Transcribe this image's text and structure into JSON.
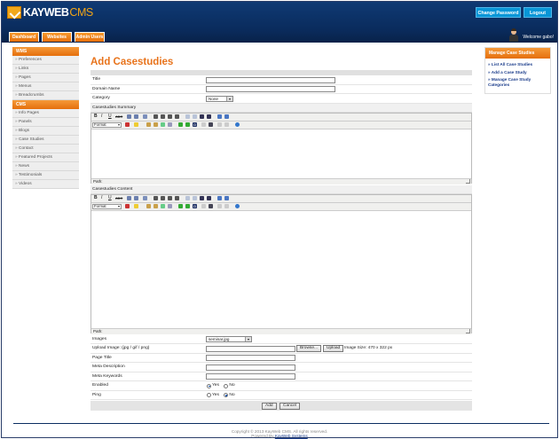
{
  "header": {
    "brand_main": "KAYWEB",
    "brand_accent": "CMS",
    "change_password": "Change Password",
    "logout": "Logout",
    "welcome": "Welcome gabo!",
    "tabs": [
      "Dashboard",
      "Websites",
      "Admin Users"
    ]
  },
  "sidebar": {
    "sections": [
      {
        "title": "WMS",
        "items": [
          "Preferences",
          "Links",
          "Pages",
          "Menus",
          "Breadcrumbs"
        ]
      },
      {
        "title": "CMS",
        "items": [
          "Info Pages",
          "Panels",
          "Blogs",
          "Case Studies",
          "Contact",
          "Featured Projects",
          "News",
          "Testimonials",
          "Videos"
        ]
      }
    ]
  },
  "main": {
    "title": "Add Casestudies",
    "fields": {
      "title": "Title",
      "domain": "Domain Name",
      "category": "Category",
      "category_value": "None",
      "summary": "Casestudies Summary",
      "content": "Casestudies Content",
      "images": "Images",
      "images_value": "seminar.jpg",
      "upload": "Upload Image: (jpg / gif / png)",
      "browse": "Browse...",
      "upload_btn": "Upload",
      "image_size": "Image Size: 470 x 322 px",
      "page_title": "Page Title",
      "meta_desc": "Meta Description",
      "meta_keywords": "Meta Keywords",
      "enabled": "Enabled",
      "ping": "Ping",
      "yes": "Yes",
      "no": "No"
    },
    "editor": {
      "format_label": "Format",
      "path_label": "Path:"
    },
    "add_btn": "Add",
    "cancel_btn": "Cancel"
  },
  "right_panel": {
    "title": "Manage Case Studies",
    "links": [
      "List All Case Studies",
      "Add a Case Study",
      "Manage Case Study Categories"
    ]
  },
  "footer": {
    "copyright": "Copyright © 2013 KayWeb CMS. All rights reserved.",
    "powered_prefix": "Powered By",
    "powered_link": "KayWeb Systems"
  },
  "colors": {
    "header_blue": "#0a2b5c",
    "accent_orange": "#e8731b",
    "button_blue": "#0996d7",
    "link_blue": "#1a3c8a"
  }
}
